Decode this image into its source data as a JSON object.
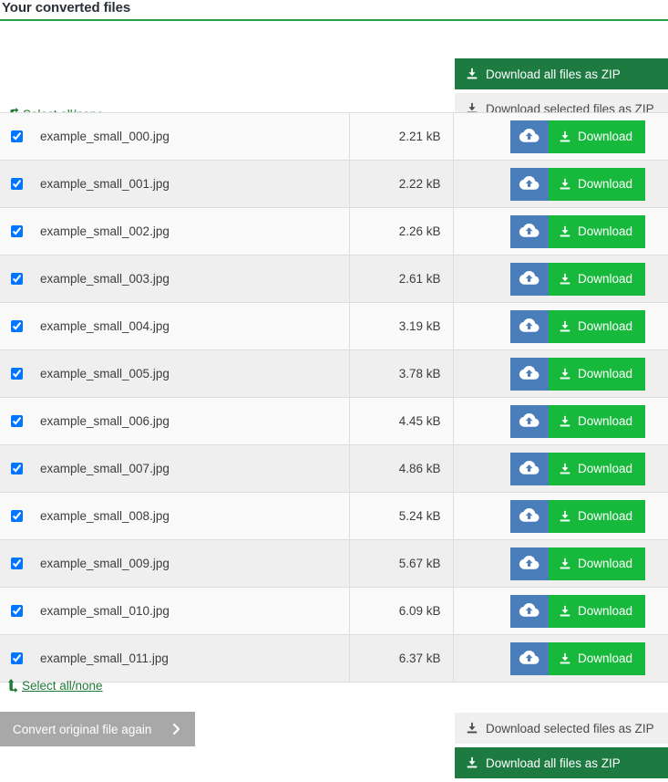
{
  "header": {
    "title": "Your converted files",
    "accent_color": "#21a14b"
  },
  "top_actions": {
    "download_all_zip": "Download all files as ZIP",
    "download_selected_zip": "Download selected files as ZIP",
    "download_all_zip_color": "#1d7b42",
    "download_selected_zip_color": "#efefef"
  },
  "select_links": {
    "top": {
      "label": "Select all/none",
      "icon": "level-down-icon"
    },
    "bottom": {
      "label": "Select all/none",
      "icon": "level-up-icon"
    },
    "link_color": "#1f7a36"
  },
  "table": {
    "download_label": "Download",
    "cloud_icon": "cloud-upload-icon",
    "download_button_color": "#17b93d",
    "cloud_button_color": "#4a7ebb",
    "rows": [
      {
        "checked": true,
        "name": "example_small_000.jpg",
        "size": "2.21 kB"
      },
      {
        "checked": true,
        "name": "example_small_001.jpg",
        "size": "2.22 kB"
      },
      {
        "checked": true,
        "name": "example_small_002.jpg",
        "size": "2.26 kB"
      },
      {
        "checked": true,
        "name": "example_small_003.jpg",
        "size": "2.61 kB"
      },
      {
        "checked": true,
        "name": "example_small_004.jpg",
        "size": "3.19 kB"
      },
      {
        "checked": true,
        "name": "example_small_005.jpg",
        "size": "3.78 kB"
      },
      {
        "checked": true,
        "name": "example_small_006.jpg",
        "size": "4.45 kB"
      },
      {
        "checked": true,
        "name": "example_small_007.jpg",
        "size": "4.86 kB"
      },
      {
        "checked": true,
        "name": "example_small_008.jpg",
        "size": "5.24 kB"
      },
      {
        "checked": true,
        "name": "example_small_009.jpg",
        "size": "5.67 kB"
      },
      {
        "checked": true,
        "name": "example_small_010.jpg",
        "size": "6.09 kB"
      },
      {
        "checked": true,
        "name": "example_small_011.jpg",
        "size": "6.37 kB"
      }
    ]
  },
  "bottom_actions": {
    "convert_again": "Convert original file again",
    "convert_again_color": "#a8a8a8",
    "download_selected_zip": "Download selected files as ZIP",
    "download_all_zip": "Download all files as ZIP"
  }
}
